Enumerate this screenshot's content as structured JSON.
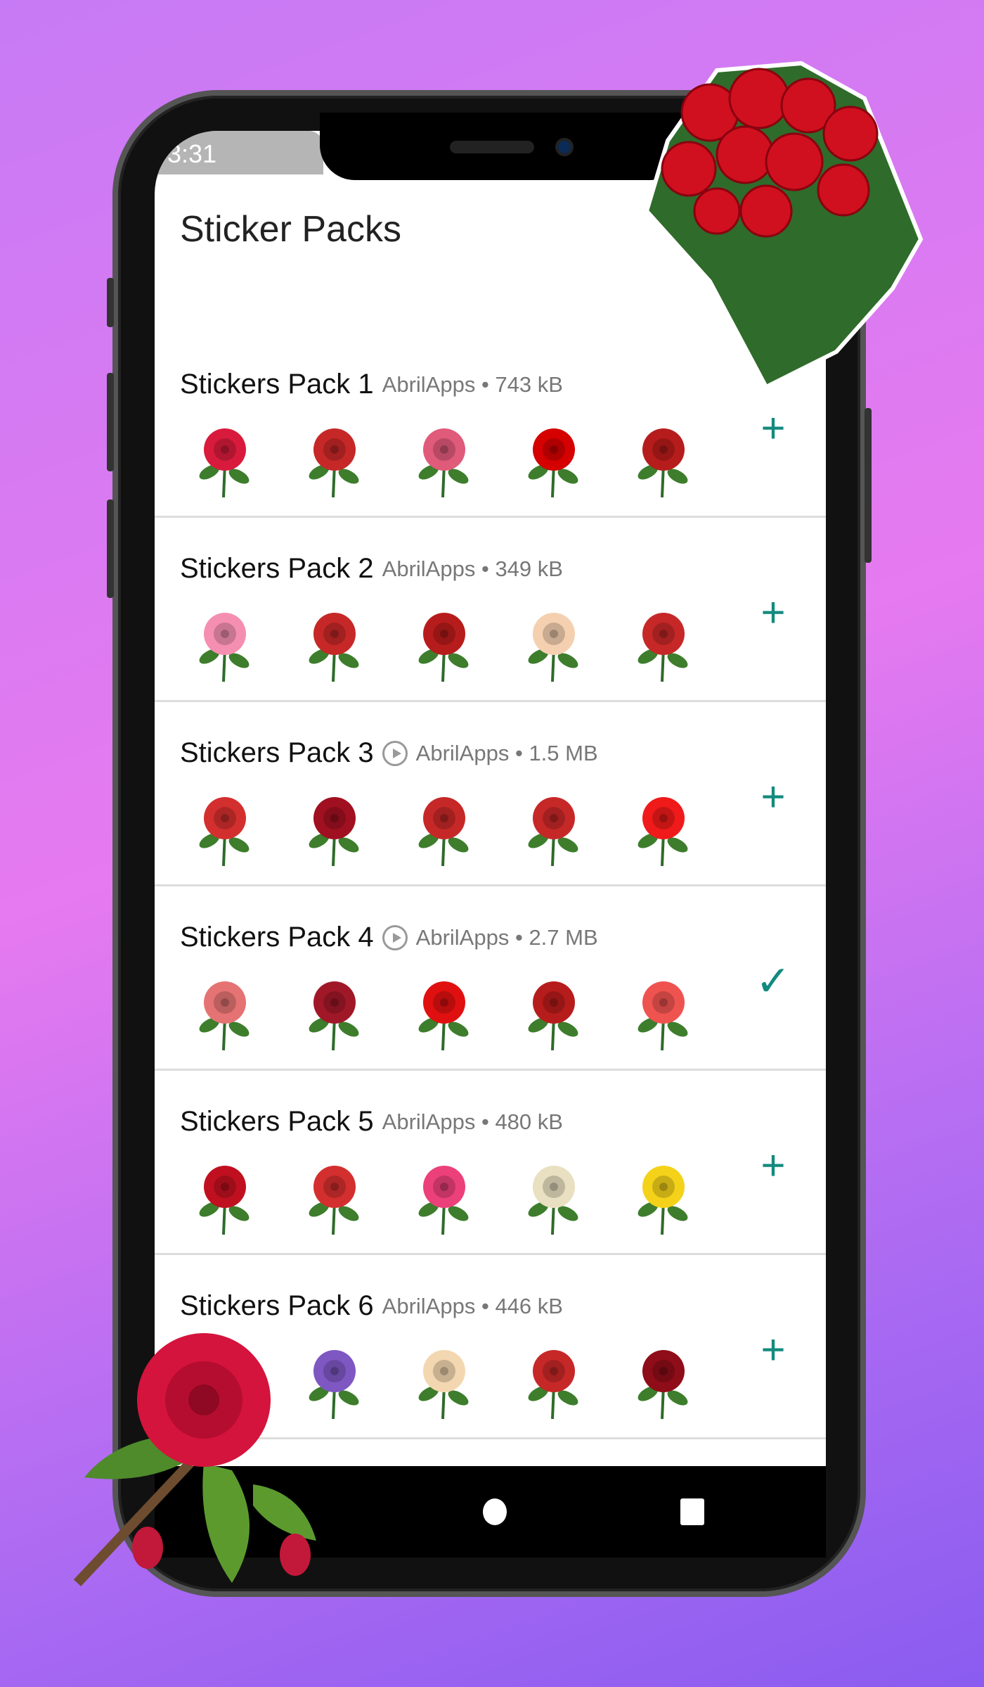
{
  "status_bar": {
    "time": "3:31"
  },
  "header": {
    "title": "Sticker Packs"
  },
  "packs": [
    {
      "name": "Stickers Pack 1",
      "publisher": "AbrilApps",
      "size": "743 kB",
      "animated": false,
      "action": "+",
      "added": false,
      "sticker_colors": [
        "#d81b3c",
        "#c62828",
        "#e05a7a",
        "#d50000",
        "#b71c1c"
      ]
    },
    {
      "name": "Stickers Pack 2",
      "publisher": "AbrilApps",
      "size": "349 kB",
      "animated": false,
      "action": "+",
      "added": false,
      "sticker_colors": [
        "#f48fb1",
        "#c62828",
        "#b71c1c",
        "#f5d0b0",
        "#c62828"
      ]
    },
    {
      "name": "Stickers Pack 3",
      "publisher": "AbrilApps",
      "size": "1.5 MB",
      "animated": true,
      "action": "+",
      "added": false,
      "sticker_colors": [
        "#d32f2f",
        "#a01020",
        "#c62828",
        "#c62828",
        "#f01a1a"
      ]
    },
    {
      "name": "Stickers Pack 4",
      "publisher": "AbrilApps",
      "size": "2.7 MB",
      "animated": true,
      "action": "✓",
      "added": true,
      "sticker_colors": [
        "#e57373",
        "#a01828",
        "#e01010",
        "#b71c1c",
        "#ef5350"
      ]
    },
    {
      "name": "Stickers Pack 5",
      "publisher": "AbrilApps",
      "size": "480 kB",
      "animated": false,
      "action": "+",
      "added": false,
      "sticker_colors": [
        "#c01020",
        "#d32f2f",
        "#ec407a",
        "#e8e0c0",
        "#f5d21a"
      ]
    },
    {
      "name": "Stickers Pack 6",
      "publisher": "AbrilApps",
      "size": "446 kB",
      "animated": false,
      "action": "+",
      "added": false,
      "sticker_colors": [
        "#f06292",
        "#7e57c2",
        "#f3d7b0",
        "#c62828",
        "#8e0d18"
      ]
    }
  ],
  "colors": {
    "accent": "#138a7e",
    "background_top": "#c77af5",
    "background_bottom": "#8a5cf0"
  }
}
